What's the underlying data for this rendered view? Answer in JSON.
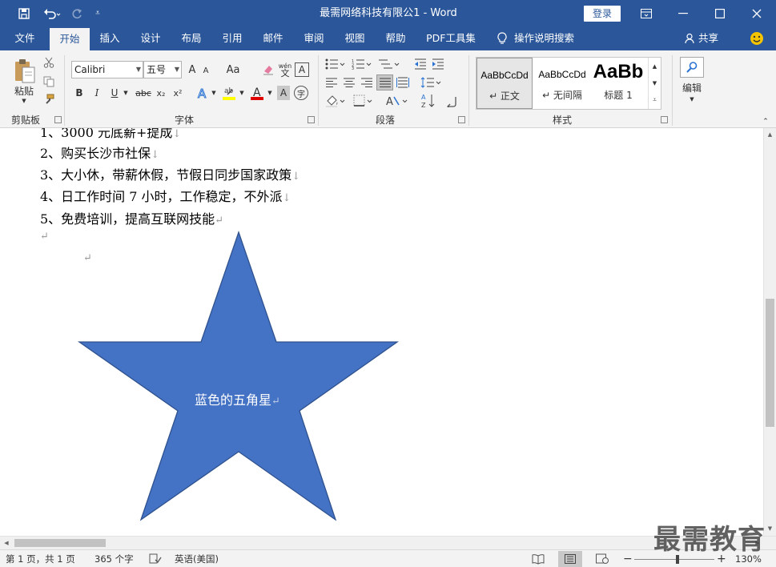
{
  "window": {
    "title": "最需网络科技有限公1 - Word",
    "login_label": "登录"
  },
  "tabs": [
    "文件",
    "开始",
    "插入",
    "设计",
    "布局",
    "引用",
    "邮件",
    "审阅",
    "视图",
    "帮助",
    "PDF工具集"
  ],
  "tell_me": "操作说明搜索",
  "share_label": "共享",
  "ribbon": {
    "clipboard": {
      "paste_label": "粘贴",
      "group_label": "剪贴板"
    },
    "font": {
      "font_name": "Calibri",
      "font_size": "五号",
      "group_label": "字体",
      "pinyin_label": "wén",
      "grow_label": "A",
      "shrink_label": "A",
      "case_label": "Aa",
      "bold": "B",
      "italic": "I",
      "underline": "U",
      "strike": "abc",
      "sub": "x₂",
      "sup": "x²",
      "border_char": "A",
      "circle_char": "字"
    },
    "paragraph": {
      "group_label": "段落"
    },
    "styles": {
      "group_label": "样式",
      "items": [
        {
          "preview": "AaBbCcDd",
          "name": "↵ 正文"
        },
        {
          "preview": "AaBbCcDd",
          "name": "↵ 无间隔"
        },
        {
          "preview": "AaBb",
          "name": "标题 1"
        }
      ]
    },
    "editing": {
      "label": "编辑"
    }
  },
  "document": {
    "lines": [
      {
        "text": "1、3000 元底薪+提成",
        "mark": "↓"
      },
      {
        "text": "2、购买长沙市社保",
        "mark": "↓"
      },
      {
        "text": "3、大小休，带薪休假，节假日同步国家政策",
        "mark": "↓"
      },
      {
        "text": "4、日工作时间 7 小时，工作稳定，不外派",
        "mark": "↓"
      },
      {
        "text": "5、免费培训，提高互联网技能",
        "mark": "↵"
      }
    ],
    "empty_mark_1": "↵",
    "empty_mark_2": "↵",
    "star_text": "蓝色的五角星",
    "star_mark": "↵",
    "star_color": "#4472c4",
    "star_border": "#2f528f"
  },
  "statusbar": {
    "page": "第 1 页，共 1 页",
    "words": "365 个字",
    "language": "英语(美国)",
    "zoom_minus": "−",
    "zoom_plus": "+",
    "zoom": "130%"
  },
  "watermark": "最需教育"
}
